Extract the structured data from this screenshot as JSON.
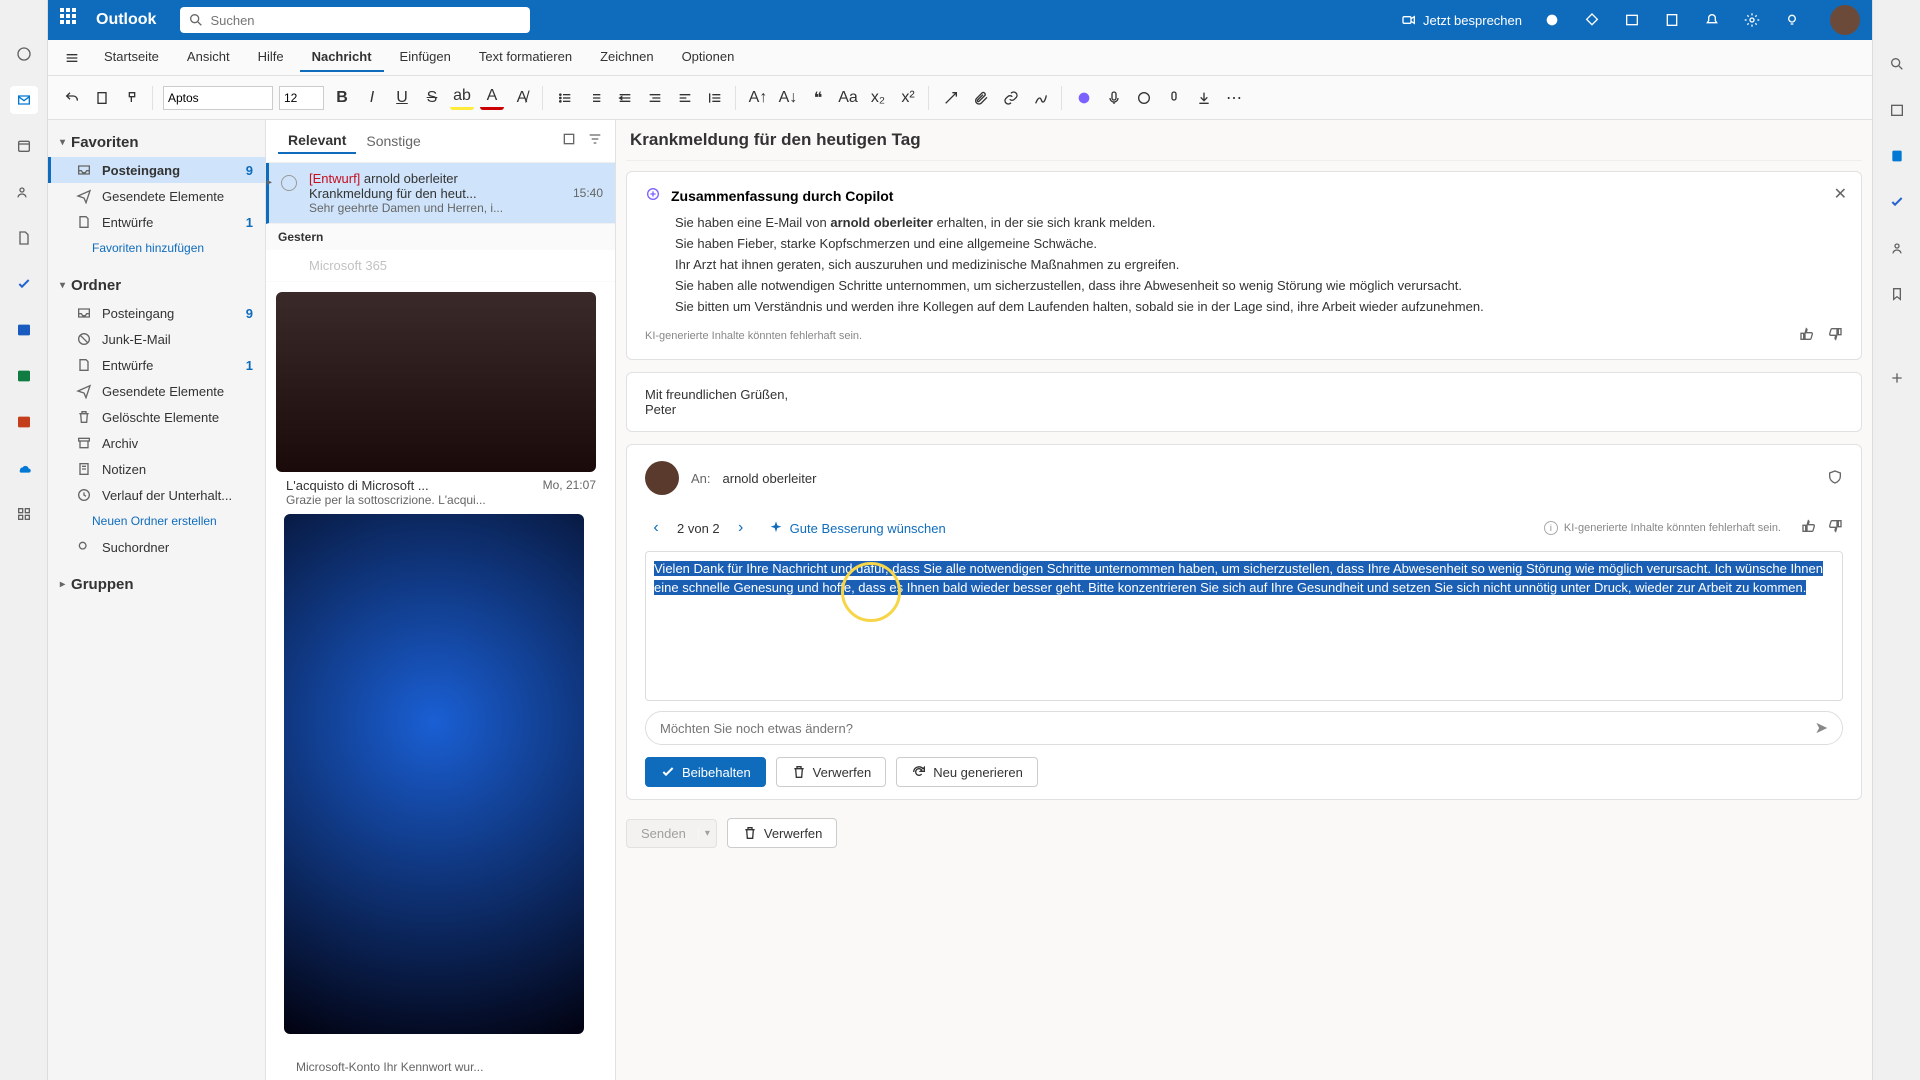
{
  "brand": "Outlook",
  "search_placeholder": "Suchen",
  "titlebar": {
    "meet_now": "Jetzt besprechen"
  },
  "ribbon_tabs": [
    "Startseite",
    "Ansicht",
    "Hilfe",
    "Nachricht",
    "Einfügen",
    "Text formatieren",
    "Zeichnen",
    "Optionen"
  ],
  "active_ribbon_tab": 3,
  "toolbar": {
    "font": "Aptos",
    "size": "12"
  },
  "folders": {
    "favorites_title": "Favoriten",
    "favorites": [
      {
        "icon": "inbox",
        "label": "Posteingang",
        "count": "9",
        "selected": true
      },
      {
        "icon": "sent",
        "label": "Gesendete Elemente"
      },
      {
        "icon": "draft",
        "label": "Entwürfe",
        "count": "1"
      }
    ],
    "add_favorite": "Favoriten hinzufügen",
    "folders_title": "Ordner",
    "items": [
      {
        "icon": "inbox",
        "label": "Posteingang",
        "count": "9"
      },
      {
        "icon": "junk",
        "label": "Junk-E-Mail"
      },
      {
        "icon": "draft",
        "label": "Entwürfe",
        "count": "1"
      },
      {
        "icon": "sent",
        "label": "Gesendete Elemente"
      },
      {
        "icon": "trash",
        "label": "Gelöschte Elemente"
      },
      {
        "icon": "archive",
        "label": "Archiv"
      },
      {
        "icon": "notes",
        "label": "Notizen"
      },
      {
        "icon": "history",
        "label": "Verlauf der Unterhalt..."
      }
    ],
    "new_folder": "Neuen Ordner erstellen",
    "search_folders": "Suchordner",
    "groups_title": "Gruppen"
  },
  "msglist": {
    "tab_focused": "Relevant",
    "tab_other": "Sonstige",
    "items": [
      {
        "draft_tag": "[Entwurf]",
        "from": "arnold oberleiter",
        "subject": "Krankmeldung für den heut...",
        "time": "15:40",
        "preview": "Sehr geehrte Damen und Herren, i...",
        "selected": true,
        "expandable": true
      }
    ],
    "date_header": "Gestern",
    "partial_from": "Microsoft 365",
    "partial_subject": "L'acquisto di Microsoft ...",
    "partial_time": "Mo, 21:07",
    "partial_preview": "Grazie per la sottoscrizione. L'acqui...",
    "bottom_preview": "Microsoft-Konto Ihr Kennwort wur..."
  },
  "reading": {
    "subject": "Krankmeldung für den heutigen Tag",
    "copilot": {
      "title": "Zusammenfassung durch Copilot",
      "line1_pre": "Sie haben eine E-Mail von ",
      "line1_bold": "arnold oberleiter",
      "line1_post": " erhalten, in der sie sich krank melden.",
      "line2": "Sie haben Fieber, starke Kopfschmerzen und eine allgemeine Schwäche.",
      "line3": "Ihr Arzt hat ihnen geraten, sich auszuruhen und medizinische Maßnahmen zu ergreifen.",
      "line4": "Sie haben alle notwendigen Schritte unternommen, um sicherzustellen, dass ihre Abwesenheit so wenig Störung wie möglich verursacht.",
      "line5": "Sie bitten um Verständnis und werden ihre Kollegen auf dem Laufenden halten, sobald sie in der Lage sind, ihre Arbeit wieder aufzunehmen.",
      "disclaimer": "KI-generierte Inhalte könnten fehlerhaft sein."
    },
    "prev_mail": {
      "closing": "Mit freundlichen Grüßen,",
      "name": "Peter"
    },
    "compose": {
      "to_label": "An:",
      "recipient": "arnold oberleiter",
      "counter": "2 von 2",
      "suggest_label": "Gute Besserung wünschen",
      "ai_note": "KI-generierte Inhalte könnten fehlerhaft sein.",
      "body": "Vielen Dank für Ihre Nachricht und dafür, dass Sie alle notwendigen Schritte unternommen haben, um sicherzustellen, dass Ihre Abwesenheit so wenig Störung wie möglich verursacht. Ich wünsche Ihnen eine schnelle Genesung und hoffe, dass es Ihnen bald wieder besser geht. Bitte konzentrieren Sie sich auf Ihre Gesundheit und setzen Sie sich nicht unnötig unter Druck, wieder zur Arbeit zu kommen.",
      "refine_placeholder": "Möchten Sie noch etwas ändern?",
      "btn_keep": "Beibehalten",
      "btn_discard": "Verwerfen",
      "btn_regen": "Neu generieren"
    },
    "bottom": {
      "send": "Senden",
      "discard": "Verwerfen"
    }
  }
}
